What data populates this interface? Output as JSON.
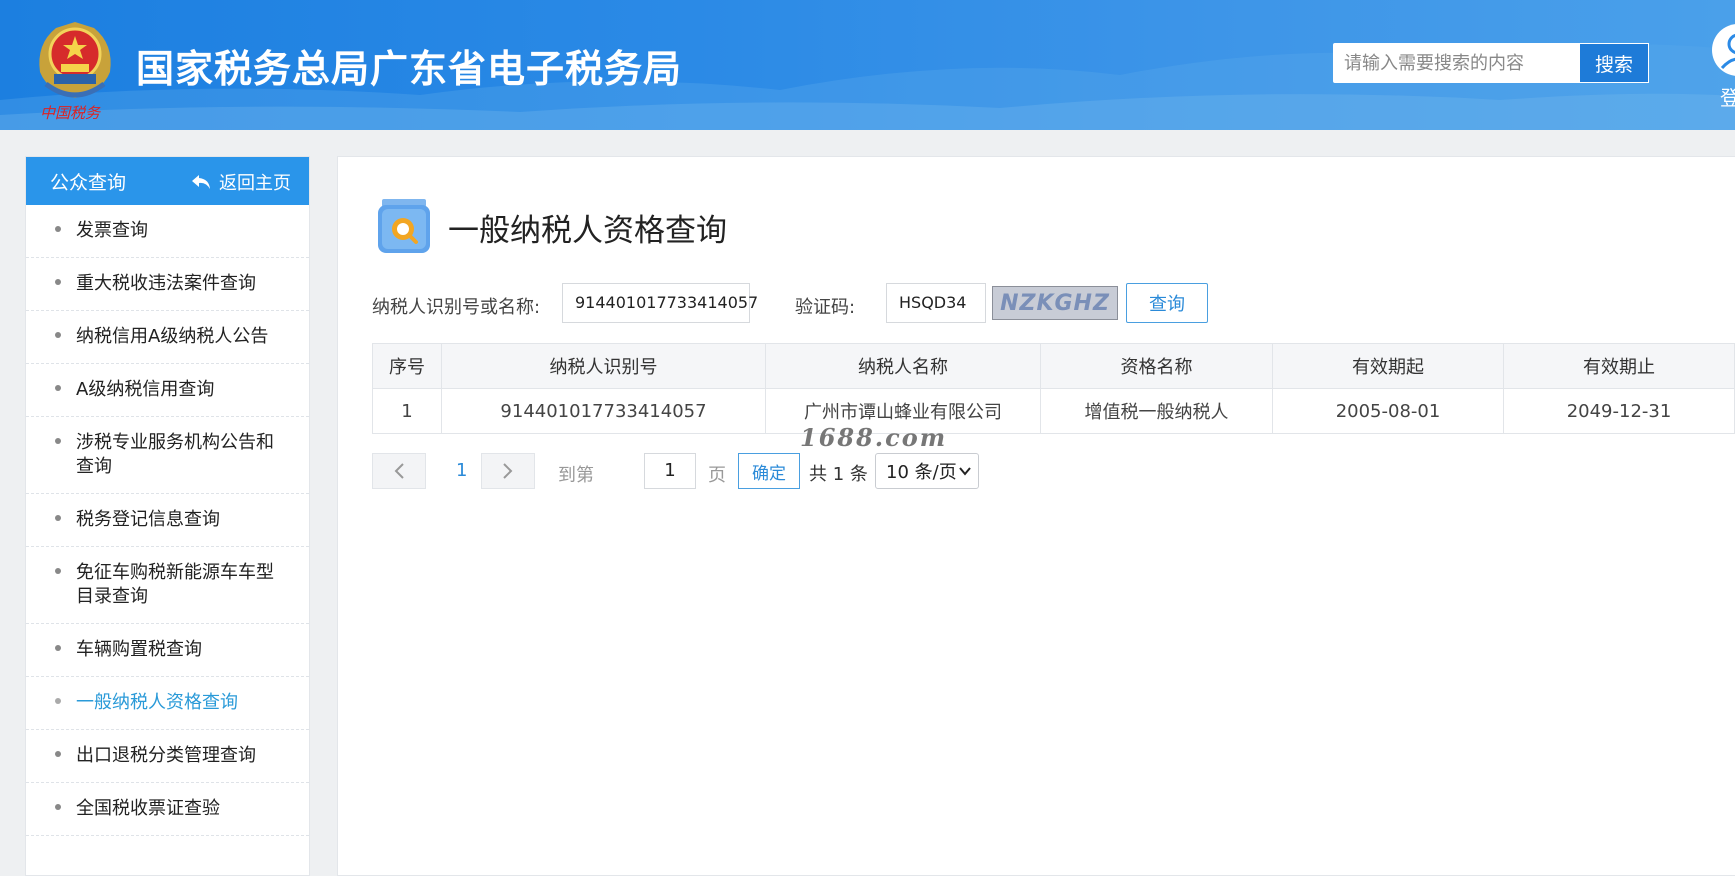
{
  "header": {
    "emblem_caption": "中国税务",
    "site_title": "国家税务总局广东省电子税务局",
    "search_placeholder": "请输入需要搜索的内容",
    "search_button": "搜索",
    "login_label": "登"
  },
  "sidebar": {
    "title": "公众查询",
    "back_label": "返回主页",
    "items": [
      {
        "label": "发票查询"
      },
      {
        "label": "重大税收违法案件查询"
      },
      {
        "label": "纳税信用A级纳税人公告"
      },
      {
        "label": "A级纳税信用查询"
      },
      {
        "label": "涉税专业服务机构公告和查询"
      },
      {
        "label": "税务登记信息查询"
      },
      {
        "label": "免征车购税新能源车车型目录查询"
      },
      {
        "label": "车辆购置税查询"
      },
      {
        "label": "一般纳税人资格查询"
      },
      {
        "label": "出口退税分类管理查询"
      },
      {
        "label": "全国税收票证查验"
      }
    ],
    "active_index": 8
  },
  "main": {
    "page_title": "一般纳税人资格查询",
    "form": {
      "taxpayer_label": "纳税人识别号或名称:",
      "taxpayer_value": "914401017733414057",
      "captcha_label": "验证码:",
      "captcha_value": "HSQD34",
      "captcha_image_text": "NZKGHZ",
      "query_button": "查询"
    },
    "table": {
      "headers": [
        "序号",
        "纳税人识别号",
        "纳税人名称",
        "资格名称",
        "有效期起",
        "有效期止"
      ],
      "rows": [
        [
          "1",
          "914401017733414057",
          "广州市谭山蜂业有限公司",
          "增值税一般纳税人",
          "2005-08-01",
          "2049-12-31"
        ]
      ]
    },
    "watermark": "1688.com",
    "pagination": {
      "current_page": "1",
      "goto_label": "到第",
      "goto_value": "1",
      "page_unit": "页",
      "confirm": "确定",
      "total": "共 1 条",
      "page_size": "10 条/页"
    }
  },
  "colors": {
    "header_blue": "#1c7fe0",
    "sidebar_head": "#2a95ea",
    "active_item": "#2a9ad8"
  }
}
